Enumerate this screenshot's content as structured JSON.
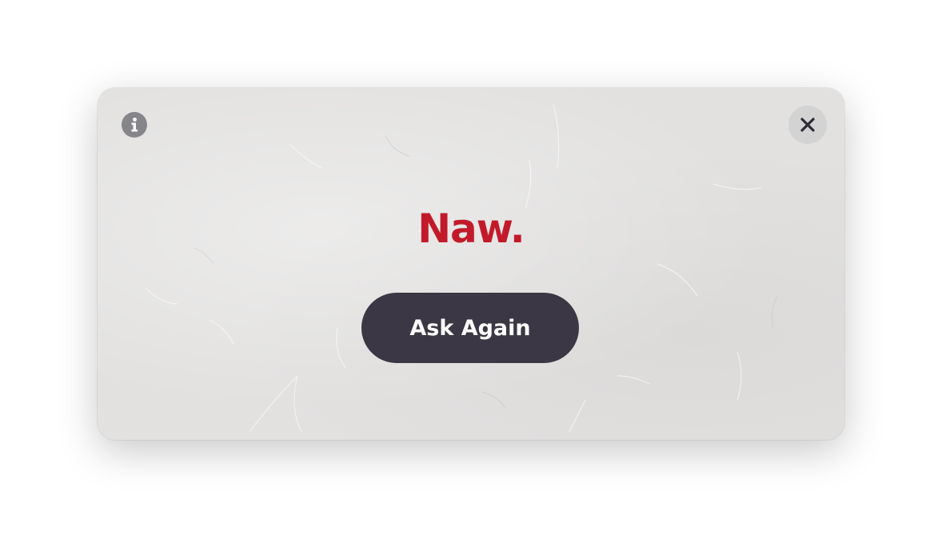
{
  "dialog": {
    "answer": "Naw.",
    "ask_again_label": "Ask Again",
    "info_icon": "info-icon",
    "close_icon": "close-icon"
  },
  "colors": {
    "answer_red": "#c21a2a",
    "button_dark": "#3b3744",
    "panel_bg": "#e2e1e0"
  }
}
